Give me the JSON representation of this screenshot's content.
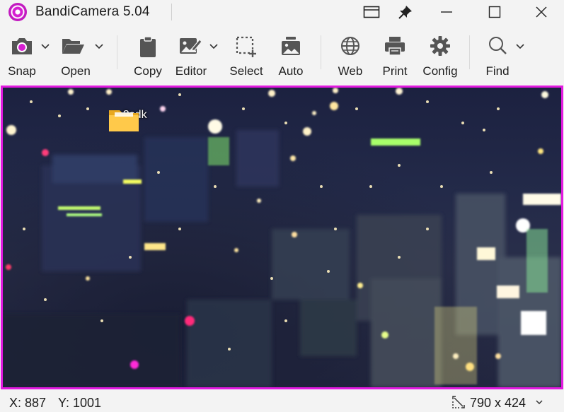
{
  "window": {
    "title": "BandiCamera 5.04",
    "accent_color": "#e21ae0"
  },
  "titlebar_buttons": [
    {
      "name": "compact-view-icon"
    },
    {
      "name": "pin-icon"
    },
    {
      "name": "minimize-icon"
    },
    {
      "name": "maximize-icon"
    },
    {
      "name": "close-icon"
    }
  ],
  "toolbar": {
    "snap": "Snap",
    "open": "Open",
    "copy": "Copy",
    "editor": "Editor",
    "select": "Select",
    "auto": "Auto",
    "web": "Web",
    "print": "Print",
    "config": "Config",
    "find": "Find"
  },
  "desktop": {
    "folder_label": "m2sdk"
  },
  "status": {
    "x": "X: 887",
    "y": "Y: 1001",
    "resolution": "790 x 424"
  }
}
